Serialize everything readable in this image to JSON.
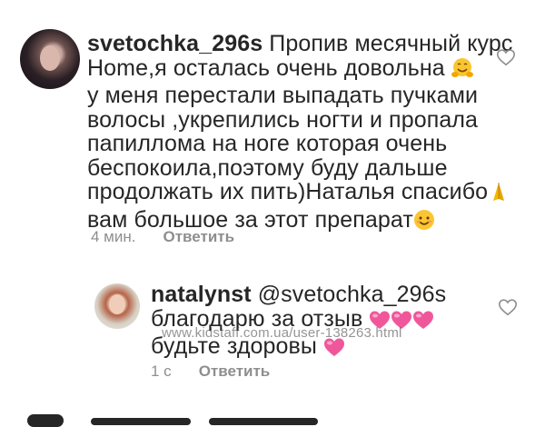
{
  "comments": [
    {
      "username": "svetochka_296s",
      "lines": [
        "Пропив месячный курс",
        "Home,я осталась очень довольна",
        "у меня перестали выпадать пучками",
        "волосы ,укрепились ногти и пропала",
        "папиллома на ноге которая очень",
        "беспокоила,поэтому буду дальше",
        "продолжать их пить)Наталья спасибо",
        "вам большое за этот препарат"
      ],
      "emojis": [
        "hugging-face",
        "folded-hands",
        "smiling-face"
      ],
      "time": "4 мин.",
      "reply_label": "Ответить",
      "like_icon": "heart-outline-icon"
    },
    {
      "username": "natalynst",
      "mention": "@svetochka_296s",
      "lines": [
        "благодарю за отзыв",
        "будьте здоровы"
      ],
      "emojis": [
        "pink-heart",
        "pink-heart",
        "pink-heart",
        "pink-heart"
      ],
      "time": "1 с",
      "reply_label": "Ответить",
      "like_icon": "heart-outline-icon"
    }
  ],
  "watermark": "www.kidstaff.com.ua/user-138263.html"
}
